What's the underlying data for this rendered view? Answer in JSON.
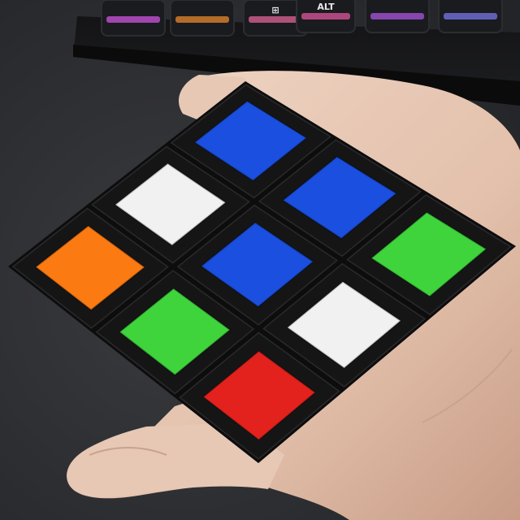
{
  "keyboard": {
    "keys": [
      {
        "legend": "",
        "glyph_color": "#b84cc8"
      },
      {
        "legend": "",
        "glyph_color": "#d07a2c"
      },
      {
        "legend": "⊞",
        "glyph_color": "#c85a8a"
      },
      {
        "legend": "ALT",
        "glyph_color": "#c84e8e"
      },
      {
        "legend": "",
        "glyph_color": "#9a4ec8"
      },
      {
        "legend": "",
        "glyph_color": "#6c6cd0"
      }
    ]
  },
  "cube": {
    "face_rows": [
      [
        "orange",
        "white",
        "blue"
      ],
      [
        "green",
        "blue",
        "blue"
      ],
      [
        "red",
        "white",
        "green"
      ]
    ],
    "sticker_colors": {
      "green": "#3fd43c",
      "red": "#e3221d",
      "white": "#f1f1f1",
      "blue": "#1a4fe0",
      "orange": "#fb7a12"
    },
    "body_color": "#0d0d0e"
  },
  "hand": {
    "skin_color": "#e7c8b5"
  },
  "desk": {
    "color": "#2f3033"
  }
}
